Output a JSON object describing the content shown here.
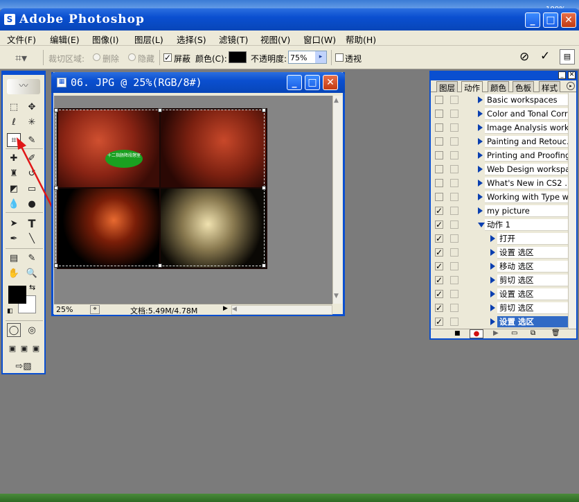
{
  "window": {
    "title": "Adobe Photoshop"
  },
  "desktop": {
    "zoom_badge": "100%"
  },
  "menu": [
    "文件(F)",
    "编辑(E)",
    "图像(I)",
    "图层(L)",
    "选择(S)",
    "滤镜(T)",
    "视图(V)",
    "窗口(W)",
    "帮助(H)"
  ],
  "options": {
    "crop_area_label": "裁切区域:",
    "delete_label": "删除",
    "hide_label": "隐藏",
    "shield_label": "屏蔽",
    "color_label": "颜色(C):",
    "opacity_label": "不透明度:",
    "opacity_value": "75%",
    "perspective_label": "透视",
    "shield_color": "#000000"
  },
  "document": {
    "title": "06. JPG @ 25%(RGB/8#)",
    "zoom": "25%",
    "doc_size": "文档:5.49M/4.78M",
    "callout": "十二指肠降段憩室"
  },
  "palette": {
    "tabs": [
      "图层",
      "动作",
      "颜色",
      "色板",
      "样式"
    ],
    "active_tab": "动作",
    "actions": [
      {
        "label": "Basic workspaces",
        "checked": false,
        "level": 0,
        "expanded": false
      },
      {
        "label": "Color and Tonal Corr…",
        "checked": false,
        "level": 0,
        "expanded": false
      },
      {
        "label": "Image Analysis work…",
        "checked": false,
        "level": 0,
        "expanded": false
      },
      {
        "label": "Painting and Retouc…",
        "checked": false,
        "level": 0,
        "expanded": false
      },
      {
        "label": "Printing and Proofing…",
        "checked": false,
        "level": 0,
        "expanded": false
      },
      {
        "label": "Web Design workspa…",
        "checked": false,
        "level": 0,
        "expanded": false
      },
      {
        "label": "What's New in CS2 …",
        "checked": false,
        "level": 0,
        "expanded": false
      },
      {
        "label": "Working with Type w…",
        "checked": false,
        "level": 0,
        "expanded": false
      },
      {
        "label": "my picture",
        "checked": true,
        "level": 0,
        "expanded": false
      },
      {
        "label": "动作 1",
        "checked": true,
        "level": 0,
        "expanded": true
      },
      {
        "label": "打开",
        "checked": true,
        "level": 1,
        "expanded": false
      },
      {
        "label": "设置 选区",
        "checked": true,
        "level": 1,
        "expanded": false
      },
      {
        "label": "移动 选区",
        "checked": true,
        "level": 1,
        "expanded": false
      },
      {
        "label": "剪切 选区",
        "checked": true,
        "level": 1,
        "expanded": false
      },
      {
        "label": "设置 选区",
        "checked": true,
        "level": 1,
        "expanded": false
      },
      {
        "label": "剪切 选区",
        "checked": true,
        "level": 1,
        "expanded": false
      },
      {
        "label": "设置 选区",
        "checked": true,
        "level": 1,
        "expanded": false,
        "selected": true
      }
    ]
  },
  "colors": {
    "accent": "#0a4fd0",
    "selected_row": "#316ac5",
    "record_red": "#d01010",
    "foreground": "#000000",
    "background": "#ffffff"
  }
}
